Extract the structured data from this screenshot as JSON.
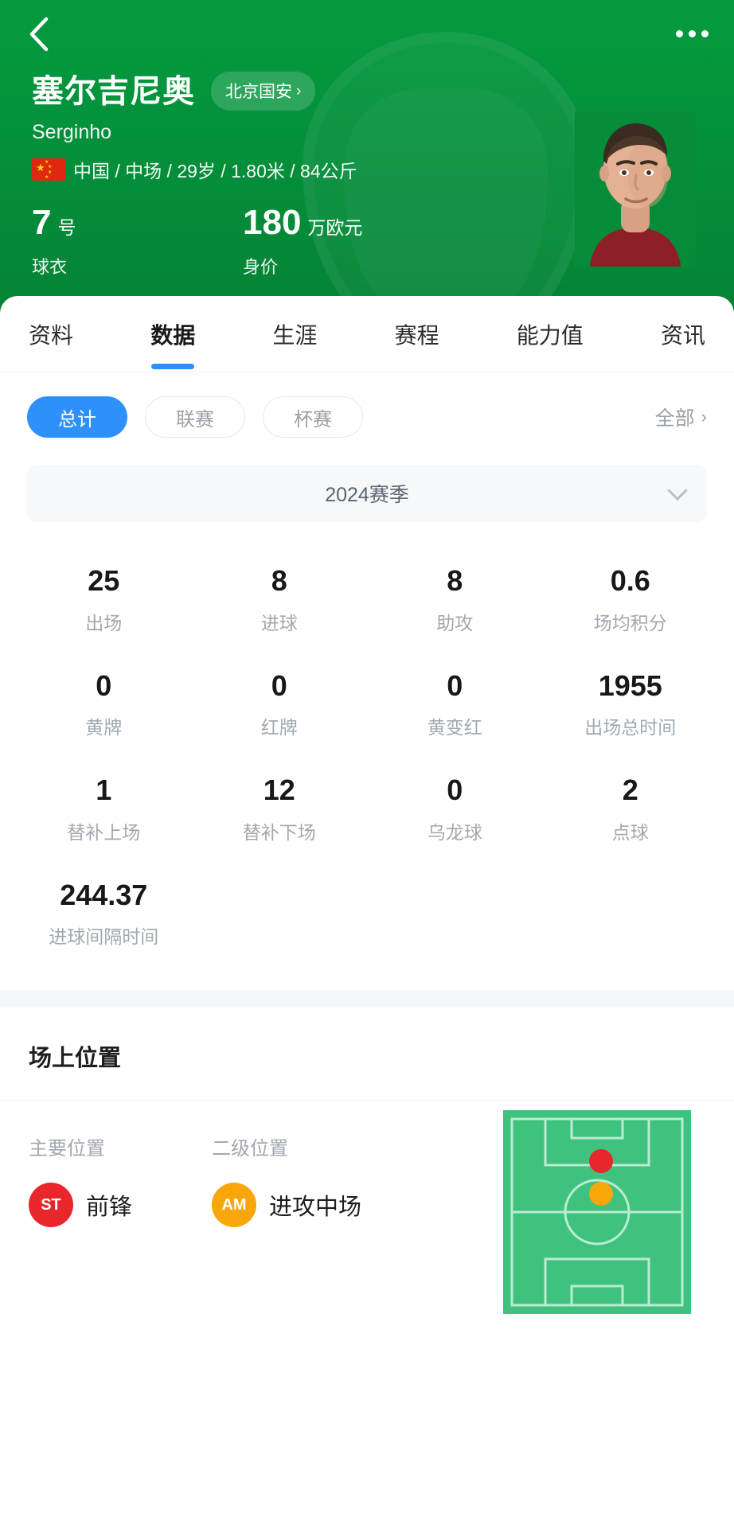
{
  "header": {
    "back_icon": "chevron-left-icon",
    "more_icon": "more-horizontal-icon",
    "player_name": "塞尔吉尼奥",
    "team_chip": "北京国安",
    "team_chip_chevron": "›",
    "player_alias": "Serginho",
    "nationality_flag": "china-flag-icon",
    "meta_line": "中国 / 中场 / 29岁 / 1.80米 / 84公斤",
    "jersey": {
      "value": "7",
      "unit": "号",
      "label": "球衣"
    },
    "market_value": {
      "value": "180",
      "unit": "万欧元",
      "label": "身价"
    },
    "avatar_icon": "player-avatar"
  },
  "tabs": [
    {
      "label": "资料",
      "active": false
    },
    {
      "label": "数据",
      "active": true
    },
    {
      "label": "生涯",
      "active": false
    },
    {
      "label": "赛程",
      "active": false
    },
    {
      "label": "能力值",
      "active": false
    },
    {
      "label": "资讯",
      "active": false
    }
  ],
  "filters": {
    "chips": [
      {
        "label": "总计",
        "selected": true
      },
      {
        "label": "联赛",
        "selected": false
      },
      {
        "label": "杯赛",
        "selected": false
      }
    ],
    "all_label": "全部",
    "all_chevron": "›"
  },
  "season": {
    "label": "2024赛季",
    "chevron_icon": "chevron-down-icon"
  },
  "stats": [
    {
      "value": "25",
      "label": "出场"
    },
    {
      "value": "8",
      "label": "进球"
    },
    {
      "value": "8",
      "label": "助攻"
    },
    {
      "value": "0.6",
      "label": "场均积分"
    },
    {
      "value": "0",
      "label": "黄牌"
    },
    {
      "value": "0",
      "label": "红牌"
    },
    {
      "value": "0",
      "label": "黄变红"
    },
    {
      "value": "1955",
      "label": "出场总时间"
    },
    {
      "value": "1",
      "label": "替补上场"
    },
    {
      "value": "12",
      "label": "替补下场"
    },
    {
      "value": "0",
      "label": "乌龙球"
    },
    {
      "value": "2",
      "label": "点球"
    },
    {
      "value": "244.37",
      "label": "进球间隔时间"
    }
  ],
  "position_section": {
    "title": "场上位置",
    "primary": {
      "label": "主要位置",
      "badge": "ST",
      "badge_color": "#e8262b",
      "text": "前锋"
    },
    "secondary": {
      "label": "二级位置",
      "badge": "AM",
      "badge_color": "#f7a70a",
      "text": "进攻中场"
    },
    "pitch": {
      "icon": "football-pitch-diagram",
      "markers": [
        {
          "role": "ST",
          "color": "#e8262b",
          "x": 0.52,
          "y": 0.25
        },
        {
          "role": "AM",
          "color": "#f7a70a",
          "x": 0.52,
          "y": 0.41
        }
      ]
    }
  },
  "colors": {
    "header_green": "#059b3f",
    "accent_blue": "#2e90fa",
    "pitch_green": "#3fc27e",
    "muted_text": "#a2a8b0"
  }
}
